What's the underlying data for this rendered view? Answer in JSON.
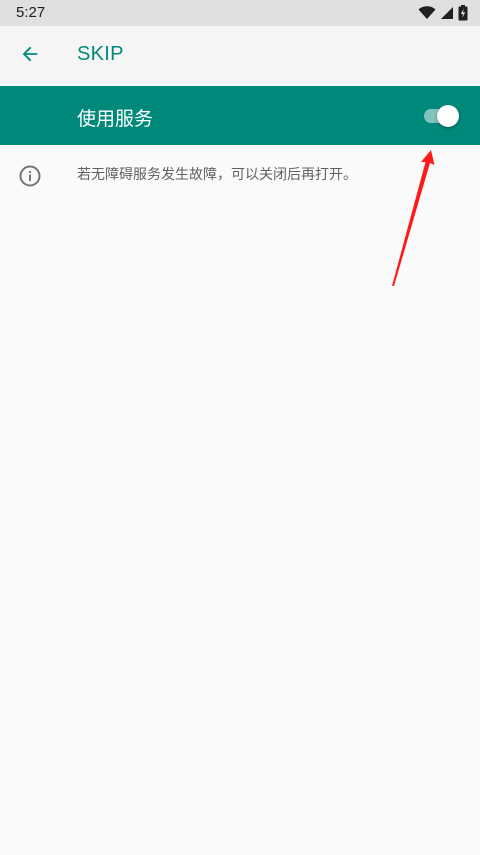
{
  "status_bar": {
    "time": "5:27",
    "icons": [
      "wifi-icon",
      "cell-signal-icon",
      "battery-charging-icon"
    ]
  },
  "toolbar": {
    "back_icon": "arrow-back-icon",
    "title": "SKIP"
  },
  "switch_bar": {
    "label": "使用服务",
    "toggle_state": "on"
  },
  "info": {
    "icon": "info-icon",
    "text": "若无障碍服务发生故障，可以关闭后再打开。"
  },
  "colors": {
    "accent": "#00897b",
    "switch_bar_bg": "#00897b",
    "toggle_track": "#80c4bd",
    "annotation_arrow": "#ff1a1a"
  }
}
